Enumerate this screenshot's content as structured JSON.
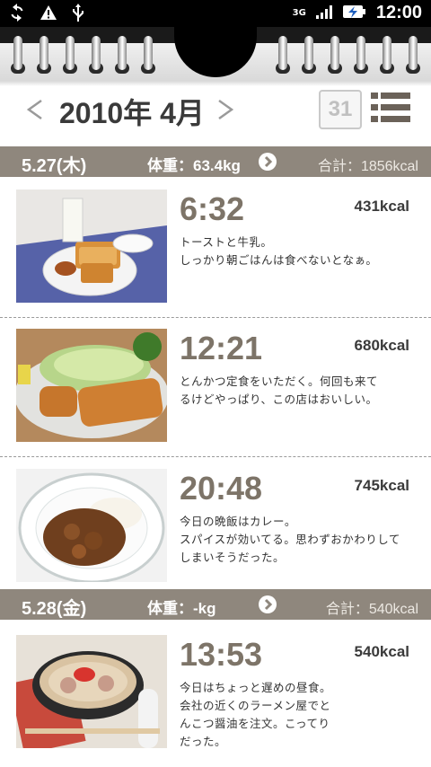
{
  "status_bar": {
    "network": "3G",
    "time": "12:00",
    "icons": [
      "sync-icon",
      "warning-icon",
      "usb-icon",
      "signal-icon",
      "battery-charging-icon"
    ]
  },
  "month_nav": {
    "title": "2010年 4月",
    "prev_icon": "chevron-left-icon",
    "next_icon": "chevron-right-icon",
    "calendar_label": "31",
    "list_icon": "list-view-icon"
  },
  "days": [
    {
      "date": "5.27(木)",
      "weight": "体重：63.4kg",
      "total": "合計：1856kcal",
      "meals": [
        {
          "time": "6:32",
          "kcal": "431kcal",
          "note": "トーストと牛乳。\nしっかり朝ごはんは食べないとなぁ。",
          "photo": "toast-breakfast"
        },
        {
          "time": "12:21",
          "kcal": "680kcal",
          "note": "とんかつ定食をいただく。何回も来て\nるけどやっぱり、この店はおいしい。",
          "photo": "tonkatsu-plate"
        },
        {
          "time": "20:48",
          "kcal": "745kcal",
          "note": "今日の晩飯はカレー。\nスパイスが効いてる。思わずおかわりして\nしまいそうだった。",
          "photo": "curry-rice"
        }
      ]
    },
    {
      "date": "5.28(金)",
      "weight": "体重：-kg",
      "total": "合計：540kcal",
      "meals": [
        {
          "time": "13:53",
          "kcal": "540kcal",
          "note": "今日はちょっと遅めの昼食。\n会社の近くのラーメン屋でと\nんこつ醤油を注文。こってり\nだった。",
          "photo": "ramen-bowl"
        }
      ]
    }
  ],
  "colors": {
    "day_header_bg": "#8f877d",
    "time_text": "#7d7468"
  }
}
